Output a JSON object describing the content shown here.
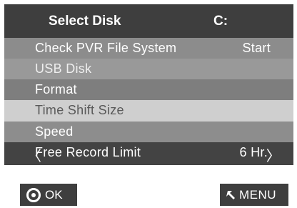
{
  "header": {
    "title": "Select Disk",
    "drive": "C:"
  },
  "menu": {
    "items": [
      {
        "label": "Check PVR File System",
        "value": "Start"
      },
      {
        "label": "USB Disk",
        "value": ""
      },
      {
        "label": "Format",
        "value": ""
      },
      {
        "label": "Time Shift Size",
        "value": ""
      },
      {
        "label": "Speed",
        "value": ""
      },
      {
        "label": "Free Record Limit",
        "value": "6 Hr."
      }
    ],
    "arrow_left": "〈",
    "arrow_right": "〉"
  },
  "footer": {
    "ok_label": "OK",
    "menu_label": "MENU",
    "ok_icon": "ok-circle-icon",
    "menu_icon": "return-arrow-icon"
  }
}
